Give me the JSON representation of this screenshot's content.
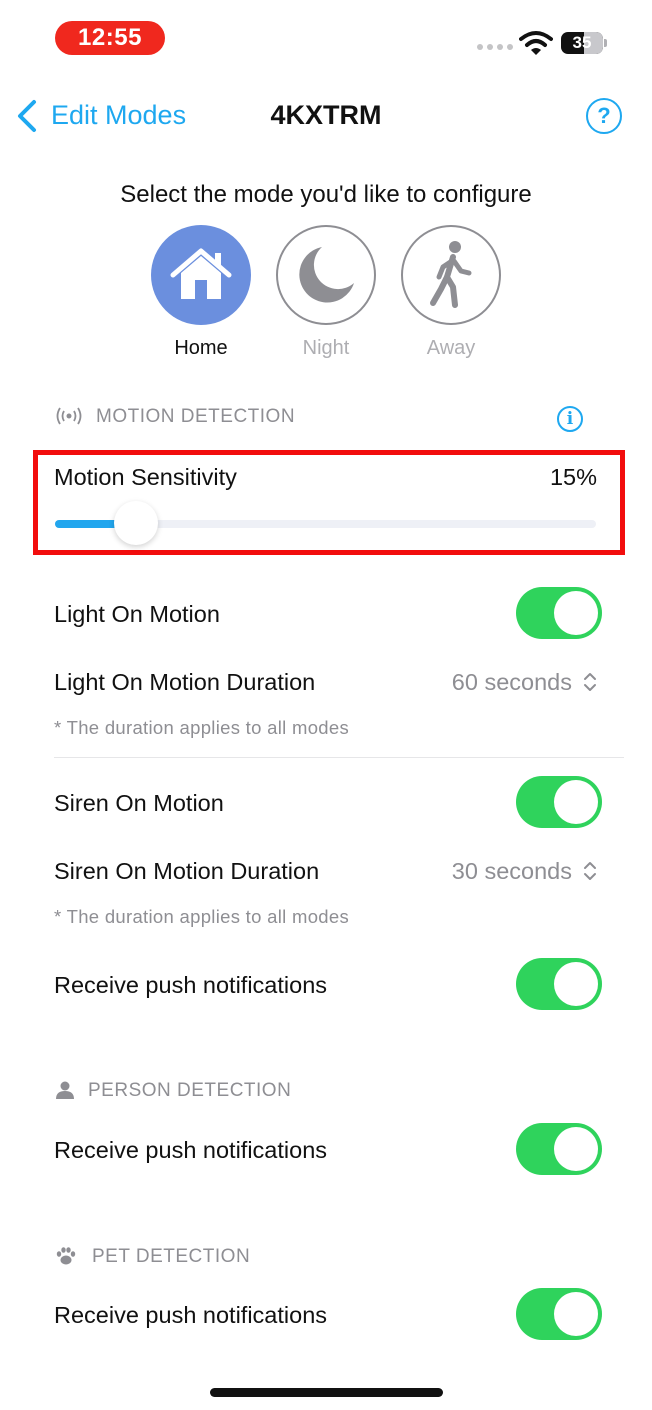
{
  "status_bar": {
    "time": "12:55",
    "battery_level": "35"
  },
  "nav": {
    "back_label": "Edit Modes",
    "title": "4KXTRM",
    "help_label": "?"
  },
  "instruction": "Select the mode you'd like to configure",
  "modes": [
    {
      "label": "Home",
      "icon": "home-icon",
      "selected": true
    },
    {
      "label": "Night",
      "icon": "moon-icon",
      "selected": false
    },
    {
      "label": "Away",
      "icon": "walking-person-icon",
      "selected": false
    }
  ],
  "motion_detection": {
    "header": "MOTION DETECTION",
    "info_label": "i",
    "sensitivity": {
      "label": "Motion Sensitivity",
      "value_text": "15%",
      "value": 15
    },
    "light_on_motion": {
      "label": "Light On Motion",
      "on": true
    },
    "light_duration": {
      "label": "Light On Motion Duration",
      "value": "60 seconds"
    },
    "light_note": "* The duration applies to all modes",
    "siren_on_motion": {
      "label": "Siren On Motion",
      "on": true
    },
    "siren_duration": {
      "label": "Siren On Motion Duration",
      "value": "30 seconds"
    },
    "siren_note": "* The duration applies to all modes",
    "push": {
      "label": "Receive push notifications",
      "on": true
    }
  },
  "person_detection": {
    "header": "PERSON DETECTION",
    "push": {
      "label": "Receive push notifications",
      "on": true
    }
  },
  "pet_detection": {
    "header": "PET DETECTION",
    "push": {
      "label": "Receive push notifications",
      "on": true
    }
  },
  "colors": {
    "accent": "#1ea8f0",
    "toggle_on": "#2fd35c",
    "selected_mode": "#6b8fde",
    "highlight": "#f20d0d"
  }
}
